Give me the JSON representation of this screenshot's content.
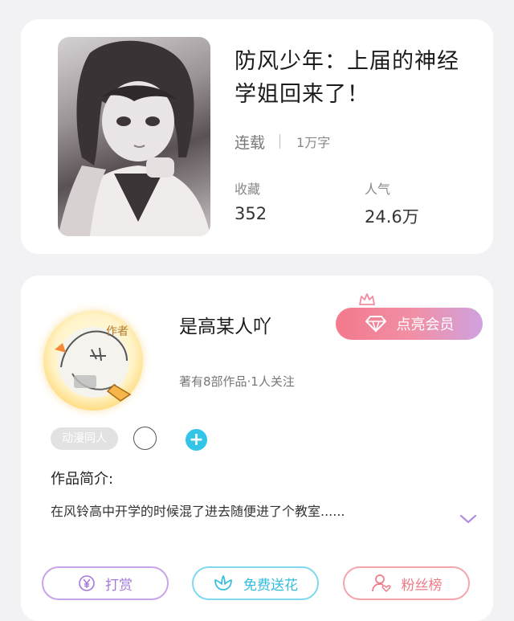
{
  "book": {
    "title": "防风少年：上届的神经学姐回来了！",
    "status": "连载",
    "word_count": "1万字",
    "favorites_label": "收藏",
    "favorites_value": "352",
    "popularity_label": "人气",
    "popularity_value": "24.6万"
  },
  "author": {
    "name": "是高某人吖",
    "info": "著有8部作品·1人关注",
    "avatar_badge": "作者",
    "vip_label": "点亮会员",
    "tag": "动漫同人",
    "add_icon": "plus-icon"
  },
  "intro": {
    "title": "作品简介:",
    "text": "在风铃高中开学的时候混了进去随便进了个教室......"
  },
  "actions": {
    "reward_label": "打赏",
    "flower_label": "免费送花",
    "fans_label": "粉丝榜"
  },
  "colors": {
    "accent_purple": "#a679d8",
    "accent_cyan": "#33bce0",
    "accent_pink": "#ee7b86",
    "vip_gradient_start": "#f4798c",
    "vip_gradient_end": "#cfa2e0"
  }
}
